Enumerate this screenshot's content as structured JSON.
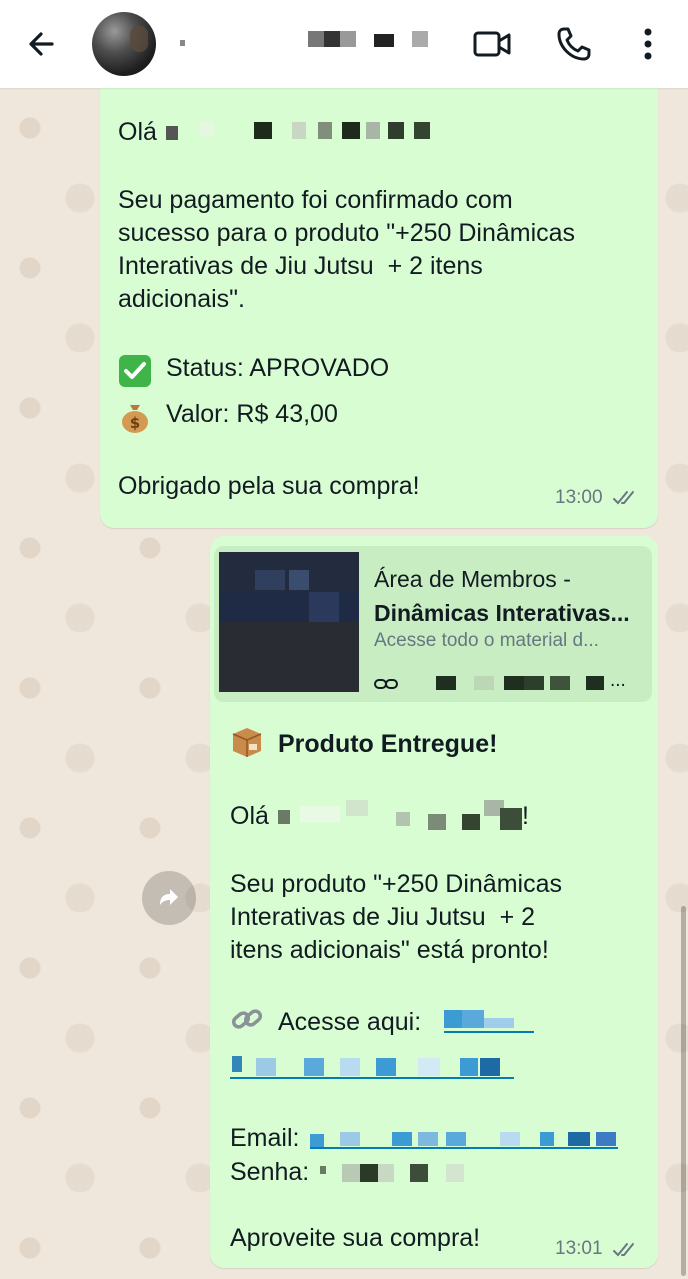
{
  "header": {
    "contact_name": "",
    "icons": [
      "back-arrow-icon",
      "video-call-icon",
      "voice-call-icon",
      "more-options-icon"
    ]
  },
  "messages": [
    {
      "greeting": "Olá",
      "body": "Seu pagamento foi confirmado com\nsucesso para o produto \"+250 Dinâmicas\nInterativas de Jiu Jutsu  + 2 itens\nadicionais\".",
      "status_line": "Status: APROVADO",
      "value_line": "Valor: R$ 43,00",
      "closing": "Obrigado pela sua compra!",
      "time": "13:00"
    },
    {
      "preview": {
        "title_line1": "Área de Membros -",
        "title_line2": "Dinâmicas Interativas...",
        "description": "Acesse todo o material d...",
        "url_suffix": "..."
      },
      "heading": "Produto Entregue!",
      "greeting": "Olá",
      "greeting_end": "!",
      "body": "Seu produto \"+250 Dinâmicas\nInterativas de Jiu Jutsu  + 2\nitens adicionais\" está pronto!",
      "access_label": "Acesse aqui:",
      "email_label": "Email:",
      "password_label": "Senha:",
      "closing": "Aproveite sua compra!",
      "time": "13:01"
    }
  ],
  "colors": {
    "bubble": "#d9fdd3",
    "preview": "#c9edc2",
    "chat_bg": "#efe7dc",
    "link": "#027eb5",
    "meta": "#667781"
  }
}
